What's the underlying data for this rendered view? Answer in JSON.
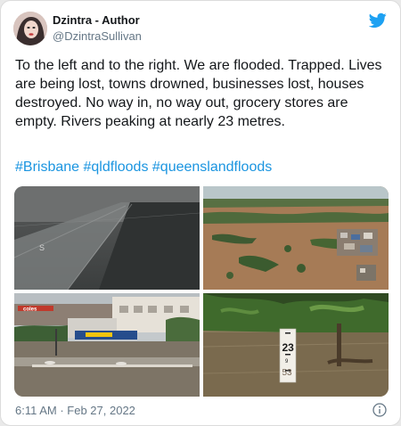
{
  "author": {
    "display_name": "Dzintra - Author",
    "handle": "@DzintraSullivan"
  },
  "tweet": {
    "text": "To the left and to the right. We are flooded. Trapped. Lives are being lost, towns drowned, businesses lost, houses destroyed. No way in, no way out, grocery stores are empty. Rivers peaking at nearly 23 metres.",
    "hashtags": [
      "#Brisbane",
      "#qldfloods",
      "#queenslandfloods"
    ],
    "timestamp": "6:11 AM · Feb 27, 2022"
  },
  "photos": {
    "cctv_marker": "S",
    "store_sign": "coles",
    "gauge_top": "23",
    "gauge_mid": "9",
    "gauge_low": "53"
  },
  "colors": {
    "twitter_blue": "#1da1f2",
    "hashtag": "#1b95e0",
    "text": "#14171a",
    "muted": "#657786"
  },
  "icons": {
    "brand": "twitter-bird-icon",
    "info": "info-icon"
  }
}
